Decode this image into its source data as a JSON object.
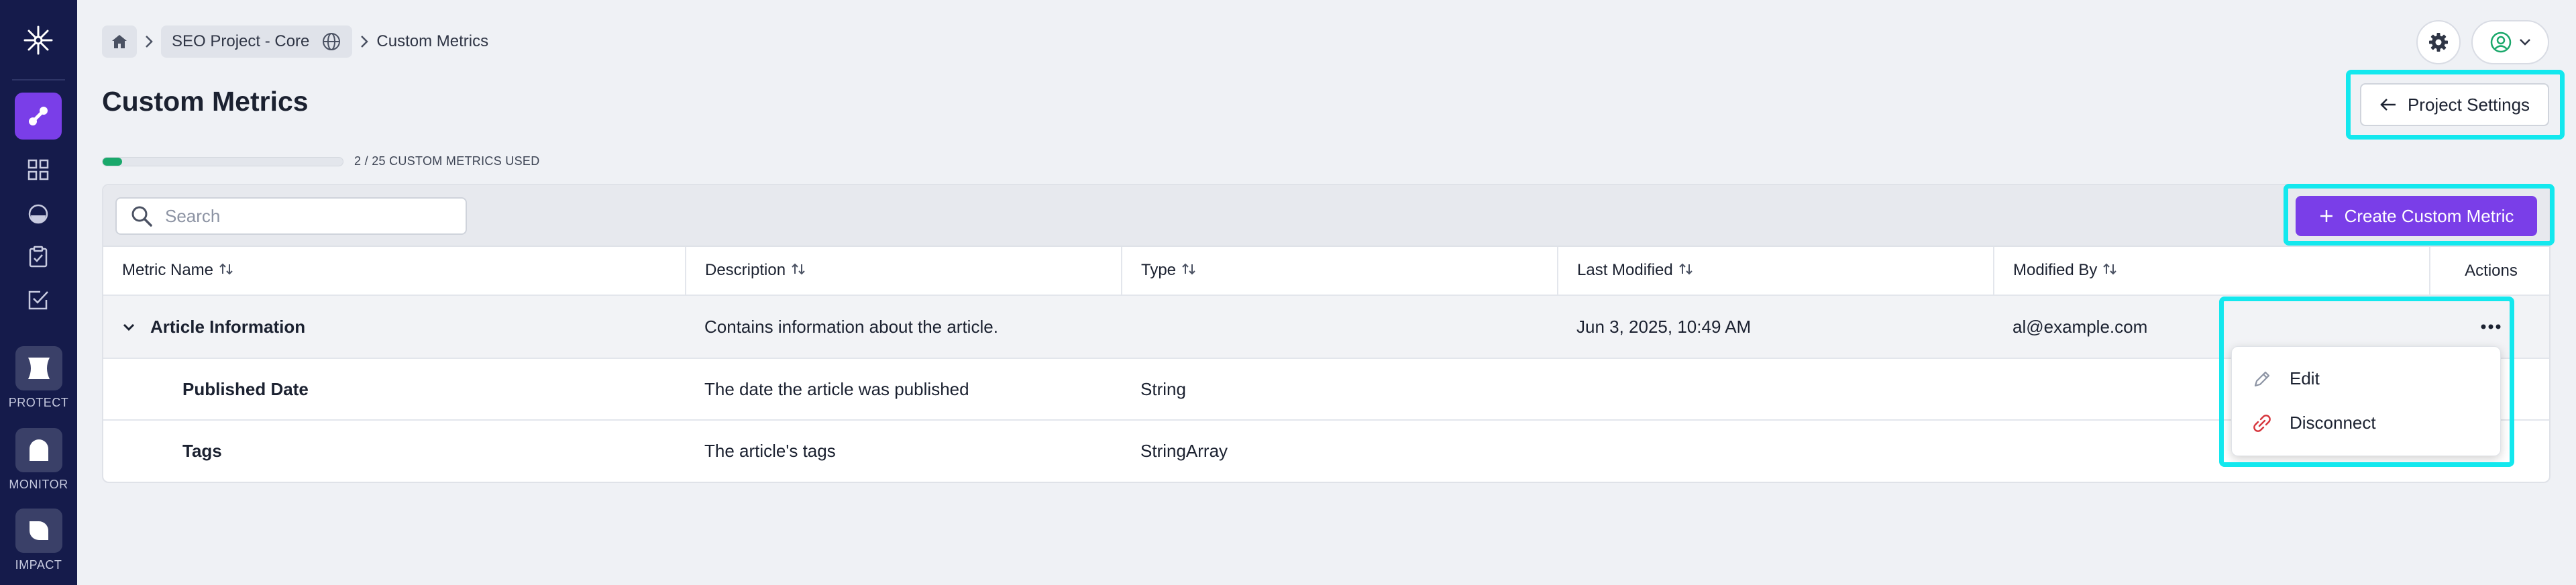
{
  "rail": {
    "items": [
      {
        "label": "PROTECT"
      },
      {
        "label": "MONITOR"
      },
      {
        "label": "IMPACT"
      }
    ]
  },
  "breadcrumb": {
    "project": "SEO Project - Core",
    "current": "Custom Metrics"
  },
  "page": {
    "title": "Custom Metrics",
    "project_settings_label": "Project Settings"
  },
  "usage": {
    "used": 2,
    "total": 25,
    "text": "2 / 25 CUSTOM METRICS USED"
  },
  "toolbar": {
    "search_placeholder": "Search",
    "create_label": "Create Custom Metric"
  },
  "table": {
    "columns": [
      "Metric Name",
      "Description",
      "Type",
      "Last Modified",
      "Modified By",
      "Actions"
    ],
    "parent": {
      "name": "Article Information",
      "description": "Contains information about the article.",
      "type": "",
      "last_modified": "Jun 3, 2025, 10:49 AM",
      "modified_by": "al@example.com"
    },
    "children": [
      {
        "name": "Published Date",
        "description": "The date the article was published",
        "type": "String"
      },
      {
        "name": "Tags",
        "description": "The article's tags",
        "type": "StringArray"
      }
    ]
  },
  "menu": {
    "edit": "Edit",
    "disconnect": "Disconnect"
  },
  "colors": {
    "accent": "#7a3ee8",
    "rail": "#151b4b",
    "highlight": "#13e8ee",
    "progress": "#1aa86b",
    "danger": "#d6333a"
  }
}
